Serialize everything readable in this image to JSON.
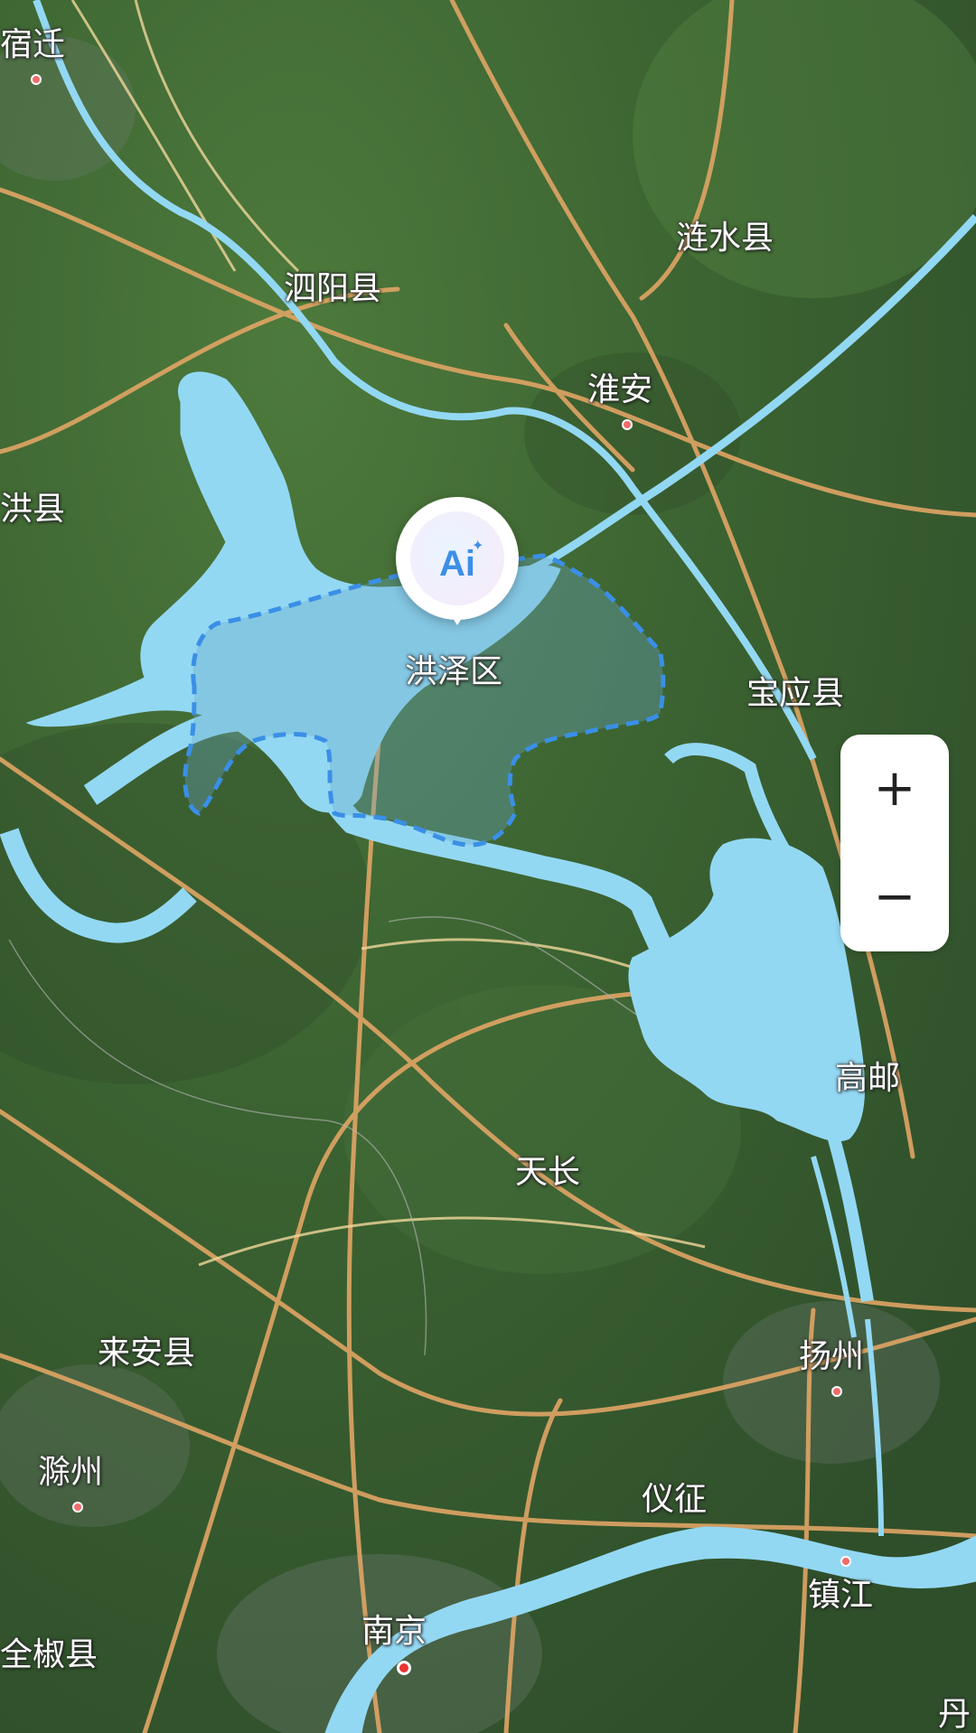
{
  "map": {
    "labels": {
      "suqian": "宿迁",
      "lianshui": "涟水县",
      "siyang": "泗阳县",
      "huaian": "淮安",
      "sihong": "洪县",
      "hongze": "洪泽区",
      "baoying": "宝应县",
      "gaoyou": "高邮",
      "tianchang": "天长",
      "laian": "来安县",
      "yangzhou": "扬州",
      "chuzhou": "滁州",
      "yizheng": "仪征",
      "zhenjiang": "镇江",
      "nanjing": "南京",
      "quanjiao": "全椒县",
      "danyang": "丹"
    },
    "colors": {
      "water": "#93d8f3",
      "highway": "#e0a565",
      "boundary": "#3a8fe6",
      "land": "#3f5e34"
    }
  },
  "ai_pin": {
    "label": "Ai",
    "icon": "ai-sparkle-icon"
  },
  "zoom": {
    "plus": "+",
    "minus": "−"
  }
}
